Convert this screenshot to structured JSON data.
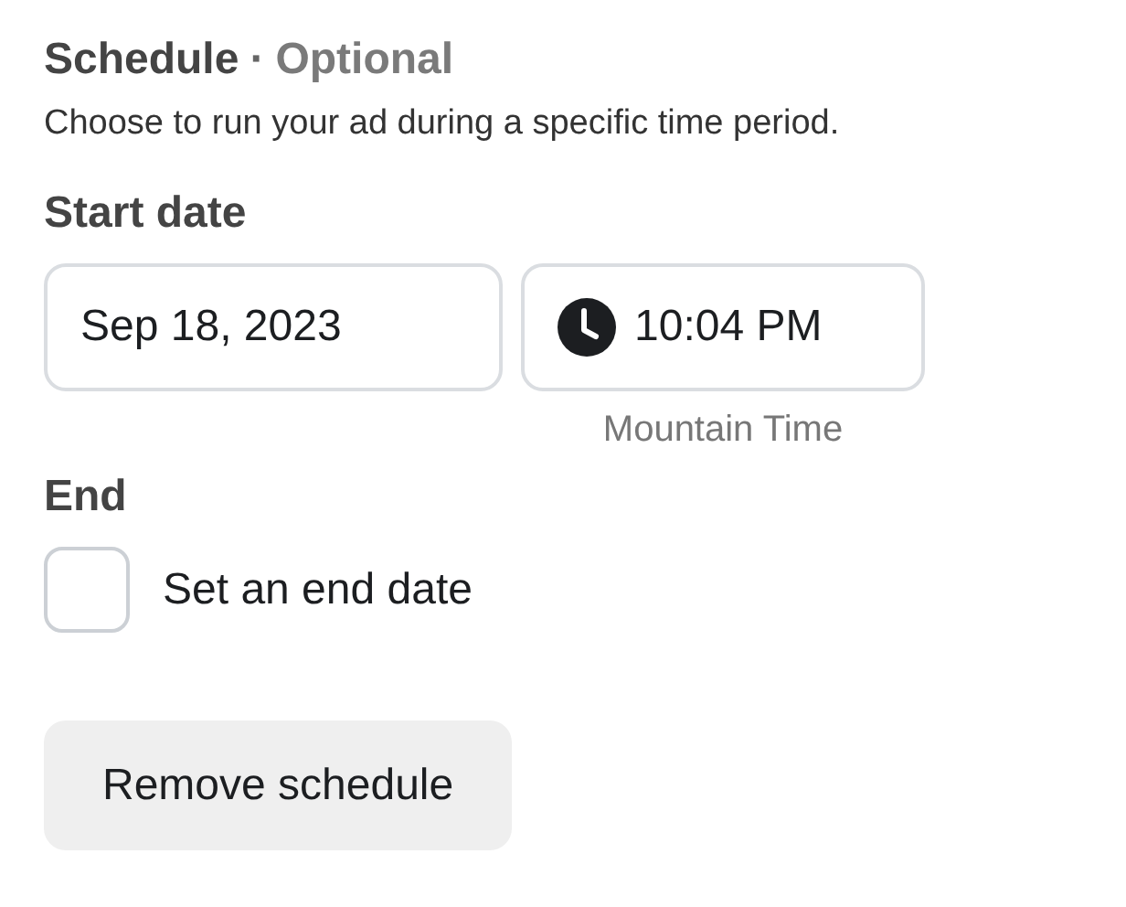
{
  "heading": {
    "title": "Schedule",
    "separator": "·",
    "tag": "Optional"
  },
  "description": "Choose to run your ad during a specific time period.",
  "start_date": {
    "label": "Start date",
    "date": "Sep 18, 2023",
    "time": "10:04 PM",
    "timezone": "Mountain Time"
  },
  "end": {
    "label": "End",
    "checkbox": {
      "label": "Set an end date",
      "checked": false
    }
  },
  "buttons": [
    "Remove schedule"
  ]
}
